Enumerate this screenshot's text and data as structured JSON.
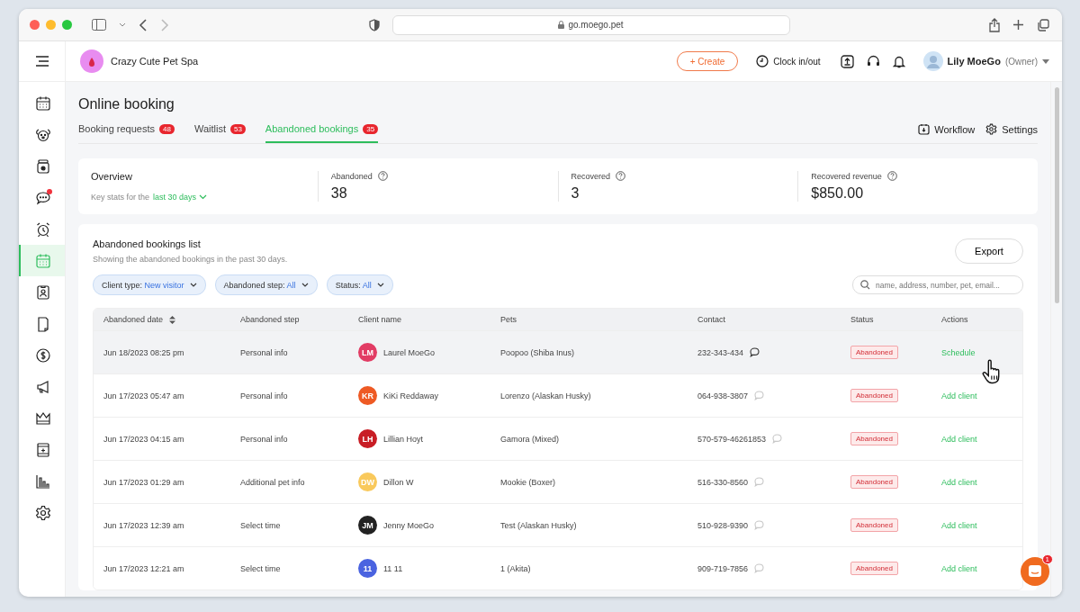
{
  "browser": {
    "address": "go.moego.pet"
  },
  "header": {
    "business": "Crazy Cute Pet Spa",
    "create": "+ Create",
    "clock": "Clock in/out",
    "user": "Lily MoeGo",
    "role": "(Owner)"
  },
  "sidebar": {
    "items": [
      {
        "kind": "calendar",
        "selected": false,
        "badge": false
      },
      {
        "kind": "dog",
        "selected": false,
        "badge": false
      },
      {
        "kind": "jar",
        "selected": false,
        "badge": false
      },
      {
        "kind": "chat",
        "selected": false,
        "badge": true
      },
      {
        "kind": "alarm",
        "selected": false,
        "badge": false
      },
      {
        "kind": "booking",
        "selected": true,
        "badge": false
      },
      {
        "kind": "idcard",
        "selected": false,
        "badge": false
      },
      {
        "kind": "document",
        "selected": false,
        "badge": false
      },
      {
        "kind": "dollar",
        "selected": false,
        "badge": false
      },
      {
        "kind": "megaphone",
        "selected": false,
        "badge": false
      },
      {
        "kind": "crown",
        "selected": false,
        "badge": false
      },
      {
        "kind": "calendar-plus",
        "selected": false,
        "badge": false
      },
      {
        "kind": "chart",
        "selected": false,
        "badge": false
      },
      {
        "kind": "gear",
        "selected": false,
        "badge": false
      }
    ]
  },
  "page": {
    "title": "Online booking"
  },
  "tabs": [
    {
      "label": "Booking requests",
      "count": "48",
      "selected": false
    },
    {
      "label": "Waitlist",
      "count": "53",
      "selected": false
    },
    {
      "label": "Abandoned bookings",
      "count": "35",
      "selected": true
    }
  ],
  "links": [
    "Workflow",
    "Settings"
  ],
  "overview": {
    "title": "Overview",
    "subtitle": "Key stats for the",
    "period": "last 30 days",
    "stats": [
      {
        "label": "Abandoned",
        "value": "38"
      },
      {
        "label": "Recovered",
        "value": "3"
      },
      {
        "label": "Recovered revenue",
        "value": "$850.00"
      }
    ]
  },
  "list": {
    "title": "Abandoned bookings list",
    "subtitle": "Showing the abandoned bookings in the past 30 days.",
    "export": "Export",
    "filters": [
      {
        "label": "Client type:",
        "value": "New visitor"
      },
      {
        "label": "Abandoned step:",
        "value": "All"
      },
      {
        "label": "Status:",
        "value": "All"
      }
    ],
    "search": {
      "placeholder": "name, address, number, pet, email..."
    }
  },
  "table": {
    "columns": [
      "Abandoned date",
      "Abandoned step",
      "Client name",
      "Pets",
      "Contact",
      "Status",
      "Actions"
    ],
    "rows": [
      {
        "date": "Jun 18/2023 08:25 pm",
        "step": "Personal info",
        "initials": "LM",
        "color": "#e23c64",
        "name": "Laurel MoeGo",
        "pets": "Poopoo (Shiba Inus)",
        "contact": "232-343-434",
        "status": "Abandoned",
        "action": "Schedule",
        "selected": true
      },
      {
        "date": "Jun 17/2023 05:47 am",
        "step": "Personal info",
        "initials": "KR",
        "color": "#ee5a24",
        "name": "KiKi Reddaway",
        "pets": "Lorenzo (Alaskan Husky)",
        "contact": "064-938-3807",
        "status": "Abandoned",
        "action": "Add client",
        "selected": false
      },
      {
        "date": "Jun 17/2023 04:15 am",
        "step": "Personal info",
        "initials": "LH",
        "color": "#c81d25",
        "name": "Lillian Hoyt",
        "pets": "Gamora (Mixed)",
        "contact": "570-579-46261853",
        "status": "Abandoned",
        "action": "Add client",
        "selected": false
      },
      {
        "date": "Jun 17/2023 01:29 am",
        "step": "Additional pet info",
        "initials": "DW",
        "color": "#f9c95c",
        "name": "Dillon W",
        "pets": "Mookie (Boxer)",
        "contact": "516-330-8560",
        "status": "Abandoned",
        "action": "Add client",
        "selected": false
      },
      {
        "date": "Jun 17/2023 12:39 am",
        "step": "Select time",
        "initials": "JM",
        "color": "#222222",
        "name": "Jenny MoeGo",
        "pets": "Test (Alaskan Husky)",
        "contact": "510-928-9390",
        "status": "Abandoned",
        "action": "Add client",
        "selected": false
      },
      {
        "date": "Jun 17/2023 12:21 am",
        "step": "Select time",
        "initials": "11",
        "color": "#4a63e0",
        "name": "11 11",
        "pets": "1 (Akita)",
        "contact": "909-719-7856",
        "status": "Abandoned",
        "action": "Add client",
        "selected": false
      }
    ]
  },
  "chat_widget": {
    "count": "1"
  }
}
